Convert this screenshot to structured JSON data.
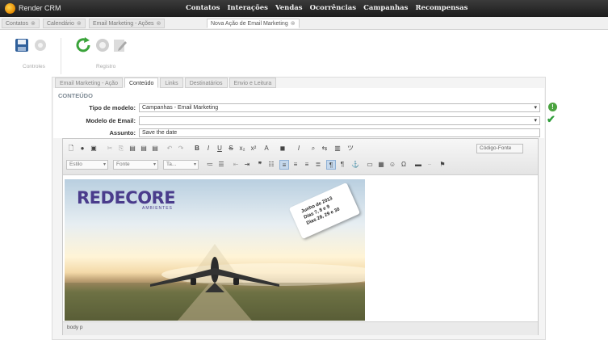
{
  "app": {
    "name": "Render CRM"
  },
  "menu": [
    "Contatos",
    "Interações",
    "Vendas",
    "Ocorrências",
    "Campanhas",
    "Recompensas"
  ],
  "page_tabs": [
    {
      "label": "Contatos"
    },
    {
      "label": "Calendário"
    },
    {
      "label": "Email Marketing - Ações"
    },
    {
      "label": "Nova Ação de Email Marketing",
      "active": true
    }
  ],
  "toolbar": {
    "group1_label": "Controles",
    "group2_label": "Registro"
  },
  "inner_tabs": [
    {
      "label": "Email Marketing - Ação"
    },
    {
      "label": "Conteúdo",
      "active": true
    },
    {
      "label": "Links"
    },
    {
      "label": "Destinatários"
    },
    {
      "label": "Envio e Leitura"
    }
  ],
  "form": {
    "section_title": "CONTEÚDO",
    "tipo_label": "Tipo de modelo:",
    "tipo_value": "Campanhas - Email Marketing",
    "modelo_label": "Modelo de Email:",
    "modelo_value": "",
    "assunto_label": "Assunto:",
    "assunto_value": "Save the date"
  },
  "editor": {
    "combos": {
      "style": "Estilo",
      "font": "Fonte",
      "size": "Ta..."
    },
    "source_label": "Código-Fonte",
    "status_path": "body p"
  },
  "banner": {
    "brand": "REDECORE",
    "brand_sub": "AMBIENTES",
    "tag_lines": [
      "Junho de 2013",
      "Dias 7, 8 e 9",
      "Dias 28, 29 e 30"
    ]
  },
  "colors": {
    "accent": "#4aa33f",
    "brand": "#4a3c8c",
    "topbar": "#2a2a2a"
  }
}
